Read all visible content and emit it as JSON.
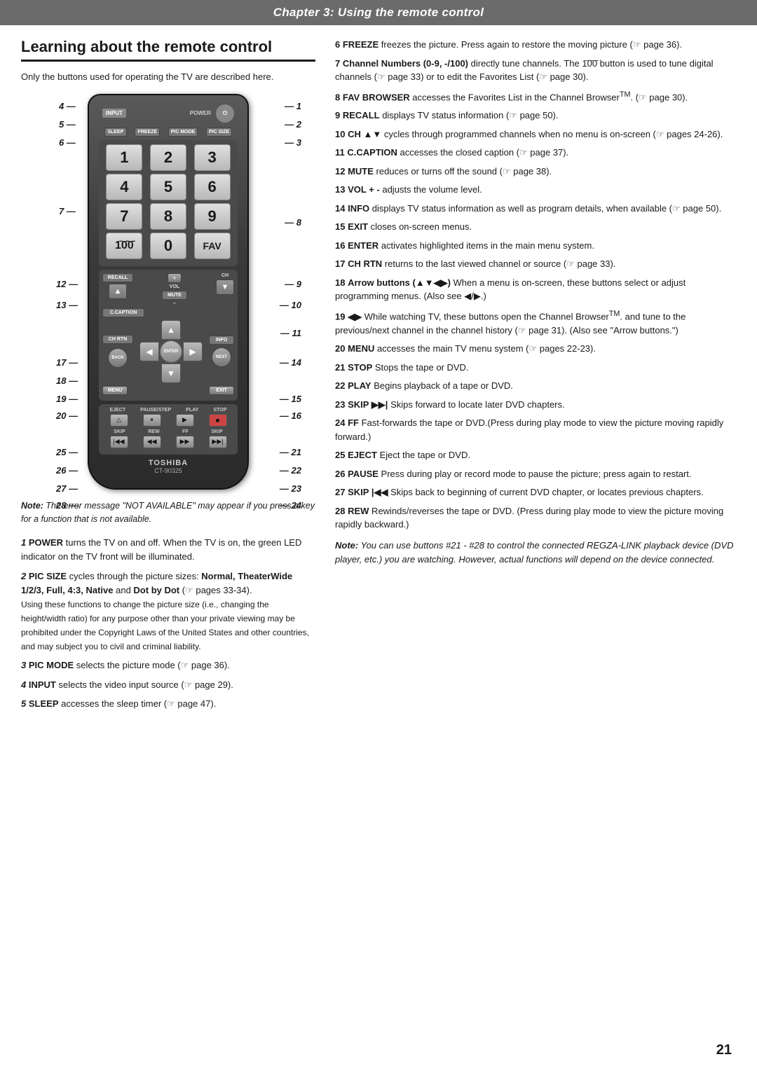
{
  "header": {
    "chapter": "Chapter 3: Using the remote control"
  },
  "section": {
    "title": "Learning about the remote control",
    "intro": "Only the buttons used for operating the TV are described here."
  },
  "remote": {
    "buttons": {
      "input": "INPUT",
      "power": "POWER ⏻",
      "sleep": "SLEEP",
      "freeze": "FREEZE",
      "picmode": "PIC MODE",
      "picsize": "PIC SIZE",
      "recall": "RECALL",
      "mute": "MUTE",
      "ch_up": "▲",
      "ch_down": "▼",
      "ccaption": "C.CAPTION",
      "chrtn": "CH RTN",
      "info": "INFO",
      "back": "BACK",
      "next": "NEXT",
      "enter": "ENTER",
      "menu": "MENU",
      "exit": "EXIT",
      "eject": "EJECT",
      "pause": "II/II",
      "play": "PLAY ▶",
      "stop": "STOP ■",
      "skip_bk": "|◀◀",
      "rew": "◀◀",
      "ff": "▶▶",
      "skip_fwd": "▶▶|",
      "nums": [
        "1",
        "2",
        "3",
        "4",
        "5",
        "6",
        "7",
        "8",
        "9"
      ],
      "hundred": "1̄0̄0̄",
      "zero": "0",
      "fav": "FAV",
      "vol_plus": "+",
      "vol_minus": "–",
      "vol_label": "VOL",
      "brand": "TOSHIBA",
      "model": "CT-90325"
    }
  },
  "side_labels_left": {
    "l4": {
      "num": "4",
      "top": "195"
    },
    "l5": {
      "num": "5",
      "top": "222"
    },
    "l6": {
      "num": "6",
      "top": "248"
    },
    "l7": {
      "num": "7",
      "top": "340"
    },
    "l12": {
      "num": "12",
      "top": "440"
    },
    "l13": {
      "num": "13",
      "top": "466"
    },
    "l17": {
      "num": "17",
      "top": "546"
    },
    "l18": {
      "num": "18",
      "top": "572"
    },
    "l19": {
      "num": "19",
      "top": "598"
    },
    "l20": {
      "num": "20",
      "top": "620"
    },
    "l25": {
      "num": "25",
      "top": "672"
    },
    "l26": {
      "num": "26",
      "top": "698"
    },
    "l27": {
      "num": "27",
      "top": "724"
    },
    "l28": {
      "num": "28",
      "top": "748"
    }
  },
  "side_labels_right": {
    "r1": {
      "num": "1",
      "top": "195"
    },
    "r2": {
      "num": "2",
      "top": "222"
    },
    "r3": {
      "num": "3",
      "top": "248"
    },
    "r8": {
      "num": "8",
      "top": "358"
    },
    "r9": {
      "num": "9",
      "top": "440"
    },
    "r10": {
      "num": "10",
      "top": "466"
    },
    "r11": {
      "num": "11",
      "top": "510"
    },
    "r14": {
      "num": "14",
      "top": "546"
    },
    "r15": {
      "num": "15",
      "top": "598"
    },
    "r16": {
      "num": "16",
      "top": "620"
    },
    "r21": {
      "num": "21",
      "top": "672"
    },
    "r22": {
      "num": "22",
      "top": "698"
    },
    "r23": {
      "num": "23",
      "top": "724"
    },
    "r24": {
      "num": "24",
      "top": "748"
    }
  },
  "note_above": {
    "text": "Note: The error message “NOT AVAILABLE” may appear if you press a key for a function that is not available."
  },
  "numbered_items_left": [
    {
      "num": "1",
      "bold": "POWER",
      "text": " turns the TV on and off. When the TV is on, the green LED indicator on the TV front will be illuminated."
    },
    {
      "num": "2",
      "bold": "PIC SIZE",
      "text": " cycles through the picture sizes: ",
      "bold2": "Normal, TheaterWide 1/2/3, Full, 4:3, Native",
      "text2": " and ",
      "bold3": "Dot by Dot",
      "text3": " (☞ pages 33-34).",
      "extra": "Using these functions to change the picture size (i.e., changing the height/width ratio) for any purpose other than your private viewing may be prohibited under the Copyright Laws of the United States and other countries, and may subject you to civil and criminal liability."
    },
    {
      "num": "3",
      "bold": "PIC MODE",
      "text": " selects the picture mode (☞ page 36)."
    },
    {
      "num": "4",
      "bold": "INPUT",
      "text": " selects the video input source (☞ page 29)."
    },
    {
      "num": "5",
      "bold": "SLEEP",
      "text": " accesses the sleep timer (☞ page 47)."
    }
  ],
  "numbered_items_right": [
    {
      "num": "6",
      "bold": "FREEZE",
      "text": " freezes the picture. Press again to restore the moving picture (☞ page 36)."
    },
    {
      "num": "7",
      "bold": "Channel Numbers (0-9, -/100)",
      "text": " directly tune channels. The 1̄0̄0̄ button is used to tune digital channels (☞ page 33) or to edit the Favorites List (☞ page 30)."
    },
    {
      "num": "8",
      "bold": "FAV BROWSER",
      "text": " accesses the Favorites List in the Channel Browserᴴᴹ. (☞ page 30)."
    },
    {
      "num": "9",
      "bold": "RECALL",
      "text": " displays TV status information (☞ page 50)."
    },
    {
      "num": "10",
      "bold": "CH ▲▼",
      "text": " cycles through programmed channels when no menu is on-screen (☞ pages 24-26)."
    },
    {
      "num": "11",
      "bold": "C.CAPTION",
      "text": " accesses the closed caption (☞ page 37)."
    },
    {
      "num": "12",
      "bold": "MUTE",
      "text": " reduces or turns off the sound (☞ page 38)."
    },
    {
      "num": "13",
      "bold": "VOL + -",
      "text": " adjusts the volume level."
    },
    {
      "num": "14",
      "bold": "INFO",
      "text": " displays TV status information as well as program details, when available (☞ page 50)."
    },
    {
      "num": "15",
      "bold": "EXIT",
      "text": " closes on-screen menus."
    },
    {
      "num": "16",
      "bold": "ENTER",
      "text": " activates highlighted items in the main menu system."
    },
    {
      "num": "17",
      "bold": "CH RTN",
      "text": " returns to the last viewed channel or source (☞ page 33)."
    },
    {
      "num": "18",
      "bold": "Arrow buttons (▲▼◀▶)",
      "text": " When a menu is on-screen, these buttons select or adjust programming menus. (Also see ◀/▶.)"
    },
    {
      "num": "19",
      "bold": "◀▶",
      "text": " While watching TV, these buttons open the Channel Browserᴴᴹ. and tune to the previous/next channel in the channel history (☞ page 31). (Also see \"Arrow buttons.\")"
    },
    {
      "num": "20",
      "bold": "MENU",
      "text": " accesses the main TV menu system (☞ pages 22-23)."
    },
    {
      "num": "21",
      "bold": "STOP",
      "text": " Stops the tape or DVD."
    },
    {
      "num": "22",
      "bold": "PLAY",
      "text": " Begins playback of a tape or DVD."
    },
    {
      "num": "23",
      "bold": "SKIP ▶▶|",
      "text": " Skips forward to locate later DVD chapters."
    },
    {
      "num": "24",
      "bold": "FF",
      "text": " Fast-forwards the tape or DVD.(Press during play mode to view the picture moving rapidly forward.)"
    },
    {
      "num": "25",
      "bold": "EJECT",
      "text": " Eject the tape or DVD."
    },
    {
      "num": "26",
      "bold": "PAUSE",
      "text": " Press during play or record mode to pause the picture; press again to restart."
    },
    {
      "num": "27",
      "bold": "SKIP |◀◀",
      "text": " Skips back to beginning of current DVD chapter, or locates previous chapters."
    },
    {
      "num": "28",
      "bold": "REW",
      "text": " Rewinds/reverses the tape or DVD. (Press during play mode to view the picture moving rapidly backward.)"
    }
  ],
  "bottom_note": {
    "text": "Note: You can use buttons #21 - #28 to control the connected REGZA-LINK playback device (DVD player, etc.) you are watching. However, actual functions will depend on the device connected."
  },
  "page_num": "21"
}
